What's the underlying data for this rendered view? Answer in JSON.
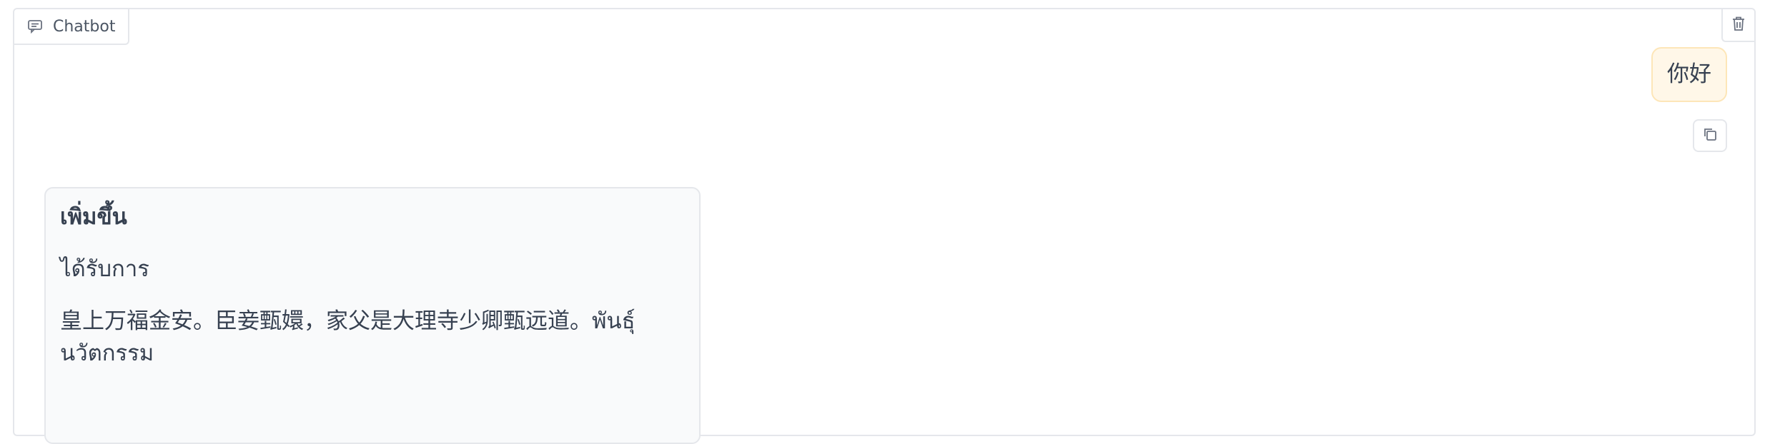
{
  "chatbot": {
    "label": "Chatbot",
    "label_icon": "chat-icon",
    "clear_icon": "trash-icon",
    "copy_icon": "copy-icon"
  },
  "messages": {
    "user": "你好",
    "bot": {
      "line1": "เพิ่มขึ้น",
      "line2": "ได้รับการ",
      "line3": "皇上万福金安。臣妾甄嬛，家父是大理寺少卿甄远道。พันธุ์นวัตกรรม"
    }
  }
}
